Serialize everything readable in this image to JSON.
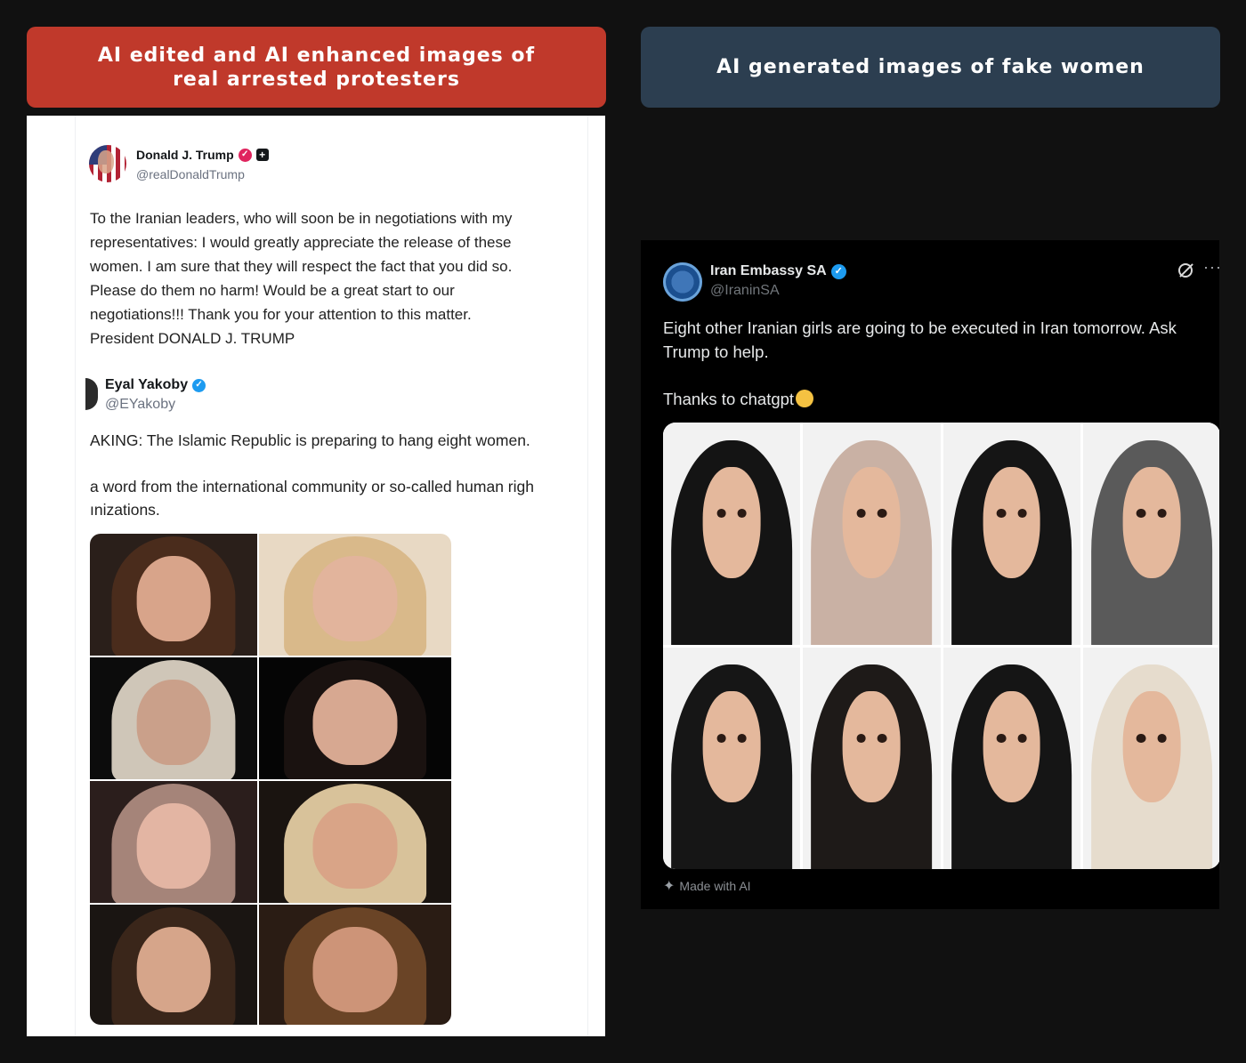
{
  "banners": {
    "left": "AI edited and AI enhanced images of real arrested protesters",
    "right": "AI generated images of fake women"
  },
  "left_post": {
    "author": {
      "name": "Donald J. Trump",
      "handle": "@realDonaldTrump"
    },
    "text_lines": [
      "To the Iranian leaders, who will soon be in negotiations with my",
      "representatives: I would greatly appreciate the release of these",
      "women. I am sure that they will respect the fact that you did so.",
      "Please do them no harm! Would be a great start to our",
      "negotiations!!! Thank you for your attention to this matter.",
      "President DONALD J. TRUMP"
    ],
    "quoted": {
      "name": "Eyal Yakoby",
      "handle": "@EYakoby",
      "line1": "AKING: The Islamic Republic is preparing to hang eight women.",
      "line2": "a word from the international community or so-called human righ",
      "line3": "ınizations."
    },
    "photos": [
      {
        "bg": "#2a1f1a",
        "hair": "#4a2c1c",
        "skin": "#d8a48a"
      },
      {
        "bg": "#e8d9c4",
        "hair": "#d9b98a",
        "skin": "#e2b49c"
      },
      {
        "bg": "#0c0c0c",
        "hair": "#cfc6b8",
        "skin": "#caa08a"
      },
      {
        "bg": "#050505",
        "hair": "#1a1210",
        "skin": "#d7a891"
      },
      {
        "bg": "#2b1e1c",
        "hair": "#a58479",
        "skin": "#e3b5a3"
      },
      {
        "bg": "#1a1410",
        "hair": "#d8c29a",
        "skin": "#d9a487"
      },
      {
        "bg": "#1a1512",
        "hair": "#3a261a",
        "skin": "#d6a58a"
      },
      {
        "bg": "#2a1c14",
        "hair": "#6a4426",
        "skin": "#cd9478"
      }
    ]
  },
  "right_post": {
    "author": {
      "name": "Iran Embassy SA",
      "handle": "@IraninSA"
    },
    "text_line1": "Eight other Iranian girls are going to be executed in Iran tomorrow. Ask",
    "text_line2": "Trump to help.",
    "text_line3": "Thanks to chatgpt",
    "photos": [
      {
        "scarf": "#141414"
      },
      {
        "scarf": "#c9b1a4"
      },
      {
        "scarf": "#151515"
      },
      {
        "scarf": "#5a5a5a"
      },
      {
        "scarf": "#161616"
      },
      {
        "scarf": "#1e1a18"
      },
      {
        "scarf": "#151515"
      },
      {
        "scarf": "#e6dccd"
      }
    ],
    "footer": "Made with AI"
  }
}
